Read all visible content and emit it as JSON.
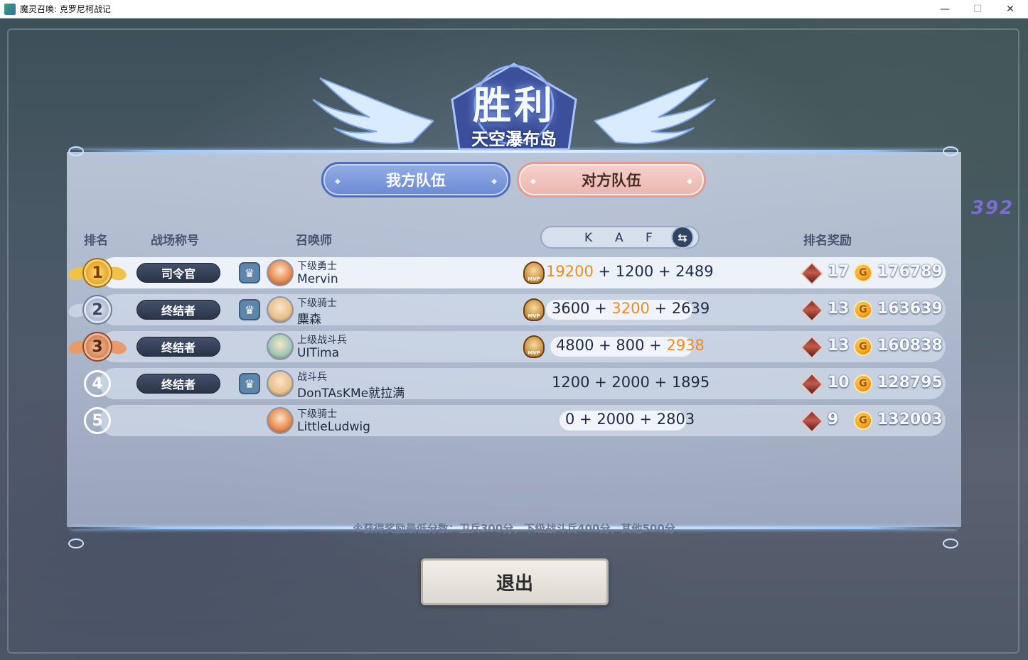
{
  "window": {
    "title": "魔灵召唤: 克罗尼柯战记",
    "minimize": "—",
    "maximize": "☐",
    "close": "✕"
  },
  "header": {
    "result": "胜利",
    "map": "天空瀑布岛",
    "side_number": "392"
  },
  "tabs": {
    "our_team": "我方队伍",
    "enemy_team": "对方队伍"
  },
  "columns": {
    "rank": "排名",
    "title": "战场称号",
    "summoner": "召唤师",
    "k": "K",
    "a": "A",
    "f": "F",
    "reward": "排名奖励"
  },
  "rows": [
    {
      "rank": "1",
      "title": "司令官",
      "team": true,
      "role": "下级勇士",
      "name": "Mervin",
      "mvp": true,
      "k": "19200",
      "a": "1200",
      "f": "2489",
      "hl": "k",
      "box": "17",
      "coins": "176789"
    },
    {
      "rank": "2",
      "title": "终结者",
      "team": true,
      "role": "下级骑士",
      "name": "麋森",
      "mvp": true,
      "k": "3600",
      "a": "3200",
      "f": "2639",
      "hl": "a",
      "box": "13",
      "coins": "163639"
    },
    {
      "rank": "3",
      "title": "终结者",
      "team": false,
      "role": "上级战斗兵",
      "name": "UITima",
      "mvp": true,
      "k": "4800",
      "a": "800",
      "f": "2938",
      "hl": "f",
      "box": "13",
      "coins": "160838"
    },
    {
      "rank": "4",
      "title": "终结者",
      "team": true,
      "role": "战斗兵",
      "name": "DonTAsKMe就拉满",
      "mvp": false,
      "k": "1200",
      "a": "2000",
      "f": "1895",
      "hl": "",
      "box": "10",
      "coins": "128795"
    },
    {
      "rank": "5",
      "title": "",
      "team": false,
      "role": "下级骑士",
      "name": "LittleLudwig",
      "mvp": false,
      "k": "0",
      "a": "2000",
      "f": "2803",
      "hl": "",
      "box": "9",
      "coins": "132003"
    }
  ],
  "mvp_label": "MVP",
  "plus": "+",
  "swap_icon": "⇆",
  "team_icon": "♛",
  "coin_symbol": "G",
  "note": "※获得奖励最低分数：卫兵300分，下级战斗兵400分，其他500分",
  "exit_label": "退出",
  "colors": {
    "highlight": "#f2891e",
    "tab_our": "#6b89d4",
    "tab_enemy": "#eab6ae"
  }
}
